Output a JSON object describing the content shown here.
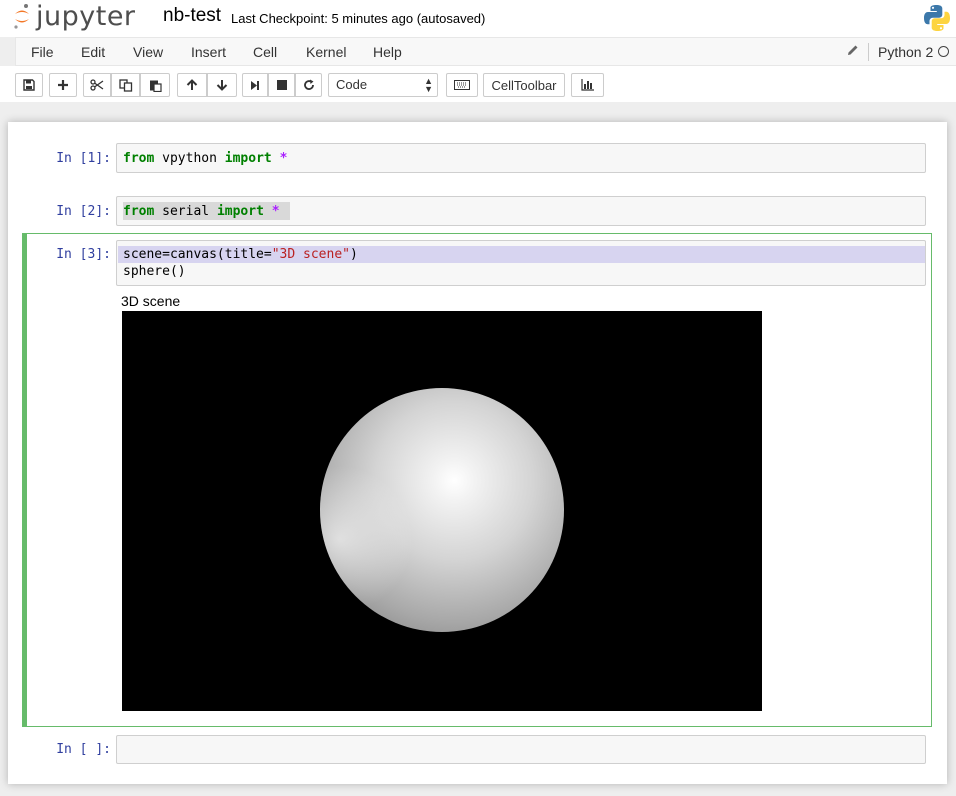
{
  "header": {
    "logo_text": "jupyter",
    "notebook_name": "nb-test",
    "checkpoint": "Last Checkpoint: 5 minutes ago (autosaved)"
  },
  "menu": {
    "items": [
      "File",
      "Edit",
      "View",
      "Insert",
      "Cell",
      "Kernel",
      "Help"
    ],
    "kernel_name": "Python 2"
  },
  "toolbar": {
    "cell_type": "Code",
    "celltoolbar_label": "CellToolbar"
  },
  "cells": [
    {
      "prompt": "In [1]:",
      "lines": [
        [
          {
            "t": "from",
            "c": "kw"
          },
          {
            "t": " vpython ",
            "c": ""
          },
          {
            "t": "import",
            "c": "kw"
          },
          {
            "t": " ",
            "c": ""
          },
          {
            "t": "*",
            "c": "op"
          }
        ]
      ]
    },
    {
      "prompt": "In [2]:",
      "lines": [
        [
          {
            "t": "from",
            "c": "kw"
          },
          {
            "t": " serial ",
            "c": ""
          },
          {
            "t": "import",
            "c": "kw"
          },
          {
            "t": " ",
            "c": ""
          },
          {
            "t": "*",
            "c": "op"
          }
        ]
      ]
    },
    {
      "prompt": "In [3]:",
      "lines": [
        [
          {
            "t": "scene=canvas(title=",
            "c": ""
          },
          {
            "t": "\"3D scene\"",
            "c": "str"
          },
          {
            "t": ")",
            "c": ""
          }
        ],
        [
          {
            "t": "sphere()",
            "c": ""
          }
        ]
      ]
    },
    {
      "prompt": "In [ ]:",
      "lines": []
    }
  ],
  "output": {
    "scene_title": "3D scene"
  },
  "colors": {
    "keyword": "#008000",
    "operator": "#aa22ff",
    "string": "#ba2121",
    "prompt": "#303f9f",
    "selected_border": "#66bb6a",
    "logo_orange": "#f37726"
  }
}
